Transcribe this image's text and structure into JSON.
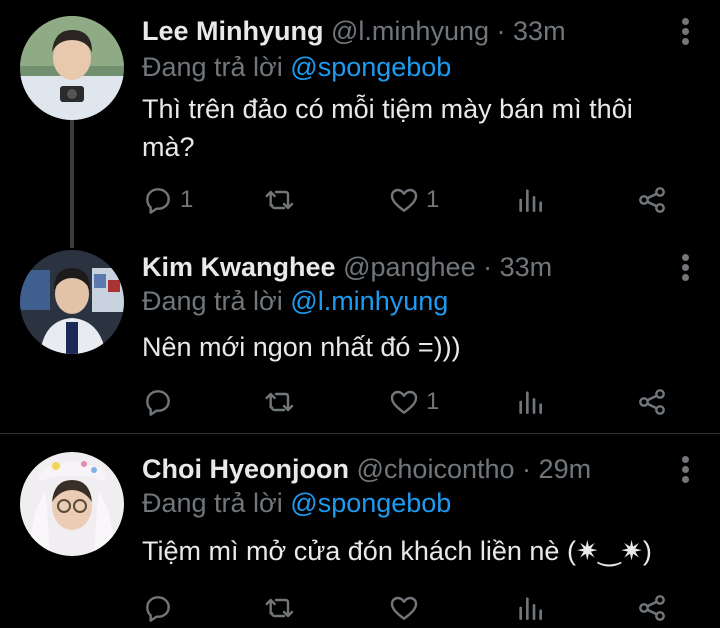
{
  "tweets": [
    {
      "name": "Lee Minhyung",
      "handle": "@l.minhyung",
      "time": "33m",
      "dot": "·",
      "reply_prefix": "Đang trả lời",
      "reply_to": "@spongebob",
      "text": "Thì trên đảo có mỗi tiệm mày bán mì thôi mà?",
      "reply_count": "1",
      "retweet_count": "",
      "like_count": "1"
    },
    {
      "name": "Kim Kwanghee",
      "handle": "@panghee",
      "time": "33m",
      "dot": "·",
      "reply_prefix": "Đang trả lời",
      "reply_to": "@l.minhyung",
      "text": "Nên mới ngon nhất đó =)))",
      "reply_count": "",
      "retweet_count": "",
      "like_count": "1"
    },
    {
      "name": "Choi Hyeonjoon",
      "handle": "@choicontho",
      "time": "29m",
      "dot": "·",
      "reply_prefix": "Đang trả lời",
      "reply_to": "@spongebob",
      "text": "Tiệm mì mở cửa đón khách liền nè (✷‿✷)",
      "reply_count": "",
      "retweet_count": "",
      "like_count": ""
    }
  ],
  "colors": {
    "background": "#000000",
    "text": "#e7e9ea",
    "secondary": "#71767b",
    "link": "#1d9bf0",
    "divider": "#2f3336"
  }
}
